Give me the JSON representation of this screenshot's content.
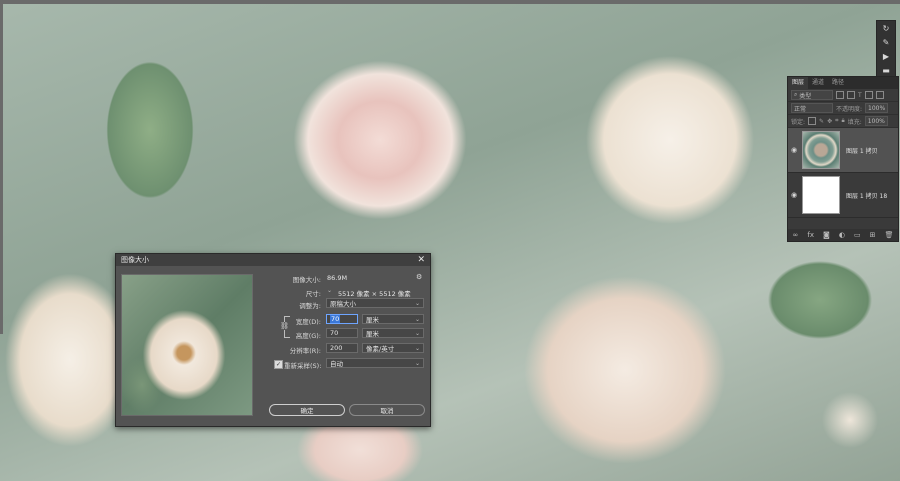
{
  "layers_panel": {
    "tabs": [
      "图层",
      "通道",
      "路径"
    ],
    "search_placeholder": "类型",
    "blend_mode": "正常",
    "opacity_label": "不透明度:",
    "opacity_value": "100%",
    "lock_label": "锁定:",
    "fill_label": "填充:",
    "fill_value": "100%",
    "layers": [
      {
        "name": "图层 1 拷贝",
        "thumb": "rose"
      },
      {
        "name": "图层 1 拷贝 18",
        "thumb": "white"
      }
    ],
    "bottom_icons": [
      "link-icon",
      "fx-icon",
      "mask-icon",
      "adjustment-icon",
      "folder-icon",
      "new-layer-icon",
      "trash-icon"
    ]
  },
  "side_toolbar": {
    "icons": [
      "rotate-icon",
      "brush-icon",
      "play-icon",
      "comment-icon"
    ]
  },
  "dialog": {
    "title": "图像大小",
    "image_size_label": "图像大小:",
    "image_size_value": "86.9M",
    "dimensions_label": "尺寸:",
    "dimensions_value": "5512 像素 × 5512 像素",
    "fit_to_label": "调整为:",
    "fit_to_value": "原稿大小",
    "width_label": "宽度(D):",
    "width_value": "70",
    "width_unit": "厘米",
    "height_label": "高度(G):",
    "height_value": "70",
    "height_unit": "厘米",
    "resolution_label": "分辨率(R):",
    "resolution_value": "200",
    "resolution_unit": "像素/英寸",
    "resample_label": "重新采样(S):",
    "resample_checked": true,
    "resample_value": "自动",
    "ok_label": "确定",
    "cancel_label": "取消"
  },
  "colors": {
    "dialog_bg": "#535353",
    "panel_bg": "#3a3a3a",
    "focus": "#3b78d8"
  }
}
